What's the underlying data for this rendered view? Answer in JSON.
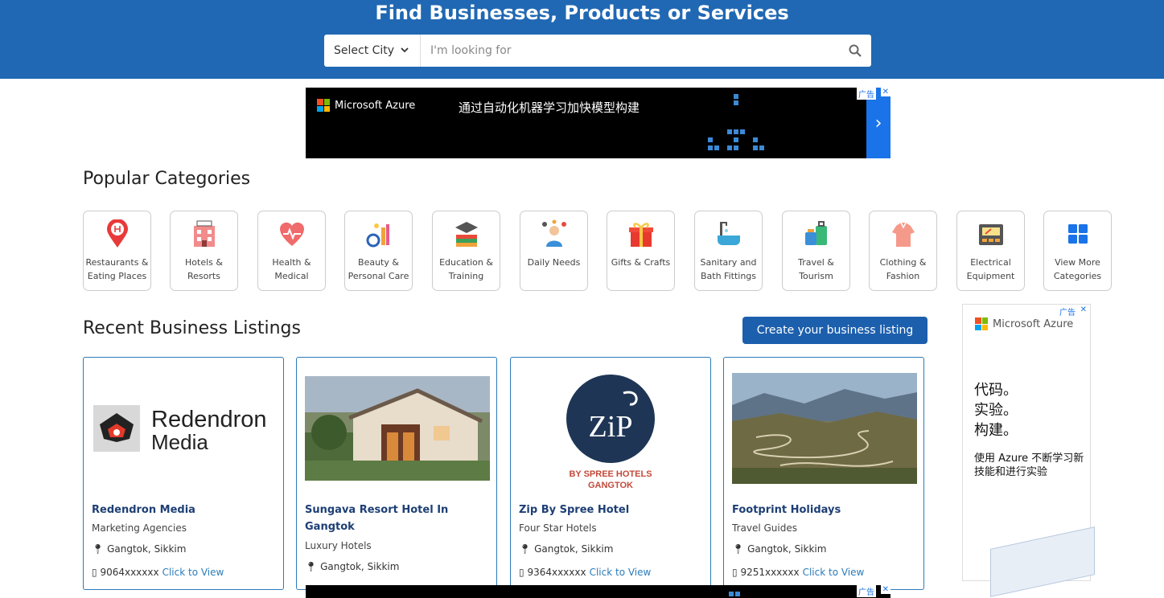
{
  "hero": {
    "title": "Find Businesses, Products or Services",
    "city_select": "Select City",
    "search_placeholder": "I'm looking for"
  },
  "top_ad": {
    "brand": "Microsoft Azure",
    "headline": "通过自动化机器学习加快模型构建",
    "tag": "广告"
  },
  "popular": {
    "title": "Popular Categories",
    "items": [
      {
        "label_1": "Restaurants &",
        "label_2": "Eating Places",
        "icon": "restaurant-pin-icon"
      },
      {
        "label_1": "Hotels &",
        "label_2": "Resorts",
        "icon": "hotel-icon"
      },
      {
        "label_1": "Health &",
        "label_2": "Medical",
        "icon": "health-heart-icon"
      },
      {
        "label_1": "Beauty &",
        "label_2": "Personal Care",
        "icon": "beauty-icon"
      },
      {
        "label_1": "Education &",
        "label_2": "Training",
        "icon": "education-icon"
      },
      {
        "label_1": "Daily Needs",
        "label_2": "",
        "icon": "daily-needs-icon"
      },
      {
        "label_1": "Gifts & Crafts",
        "label_2": "",
        "icon": "gift-icon"
      },
      {
        "label_1": "Sanitary and",
        "label_2": "Bath Fittings",
        "icon": "bathtub-icon"
      },
      {
        "label_1": "Travel &",
        "label_2": "Tourism",
        "icon": "luggage-icon"
      },
      {
        "label_1": "Clothing &",
        "label_2": "Fashion",
        "icon": "clothing-icon"
      },
      {
        "label_1": "Electrical",
        "label_2": "Equipment",
        "icon": "electrical-meter-icon"
      },
      {
        "label_1": "View More",
        "label_2": "Categories",
        "icon": "grid-icon"
      }
    ]
  },
  "recent": {
    "title": "Recent Business Listings",
    "create_button": "Create your business listing",
    "listings": [
      {
        "name": "Redendron Media",
        "category": "Marketing Agencies",
        "location": "Gangtok, Sikkim",
        "phone": "9064xxxxxx",
        "view": "Click to View",
        "logo_text_1": "Redendron",
        "logo_text_2": "Media"
      },
      {
        "name": "Sungava Resort Hotel In Gangtok",
        "category": "Luxury Hotels",
        "location": "Gangtok, Sikkim",
        "phone": "",
        "view": ""
      },
      {
        "name": "Zip By Spree Hotel",
        "category": "Four Star Hotels",
        "location": "Gangtok, Sikkim",
        "phone": "9364xxxxxx",
        "view": "Click to View",
        "logo_text_1": "ZiP",
        "logo_text_2": "BY SPREE HOTELS",
        "logo_text_3": "GANGTOK"
      },
      {
        "name": "Footprint Holidays",
        "category": "Travel Guides",
        "location": "Gangtok, Sikkim",
        "phone": "9251xxxxxx",
        "view": "Click to View"
      }
    ]
  },
  "side_ad": {
    "brand": "Microsoft Azure",
    "tag": "广告",
    "line1": "代码。",
    "line2": "实验。",
    "line3": "构建。",
    "small": "使用 Azure 不断学习新技能和进行实验"
  },
  "bottom_ad": {
    "tag": "广告"
  },
  "colors": {
    "primary": "#2068b3",
    "button": "#1c5fad",
    "card_border": "#2b7bb9",
    "title_link": "#1d3f75"
  }
}
